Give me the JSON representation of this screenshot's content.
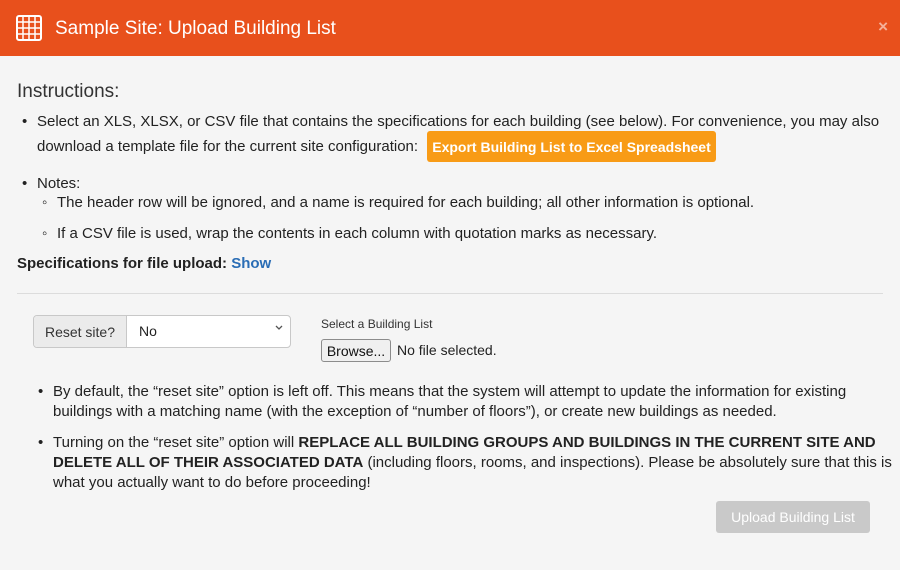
{
  "header": {
    "title": "Sample Site: Upload Building List",
    "close_label": "×",
    "icon": "building-icon",
    "background": "#e8501c"
  },
  "instructions": {
    "title": "Instructions:",
    "bullet1_line1": "Select an XLS, XLSX, or CSV file that contains the specifications for each building (see below). For convenience, you may also",
    "bullet1_line2": "download a template file for the current site configuration:",
    "export_button": "Export Building List to Excel Spreadsheet",
    "notes_label": "Notes:",
    "note1": "The header row will be ignored, and a name is required for each building; all other information is optional.",
    "note2": "If a CSV file is used, wrap the contents in each column with quotation marks as necessary."
  },
  "specifications": {
    "label": "Specifications for file upload:",
    "link": "Show"
  },
  "reset": {
    "label": "Reset site?",
    "selected": "No"
  },
  "file": {
    "label": "Select a Building List",
    "browse": "Browse...",
    "status": "No file selected."
  },
  "info": {
    "b1_line1": "By default, the “reset site” option is left off. This means that the system will attempt to update the information for existing",
    "b1_line2": "buildings with a matching name (with the exception of “number of floors”), or create new buildings as needed.",
    "b2_line1_a": "Turning on the “reset site” option will ",
    "b2_line1_b": "REPLACE ALL BUILDING GROUPS AND BUILDINGS IN THE CURRENT SITE AND",
    "b2_line2_a": "DELETE ALL OF THEIR ASSOCIATED DATA",
    "b2_line2_b": " (including floors, rooms, and inspections). Please be absolutely sure that this is",
    "b2_line3": "what you actually want to do before proceeding!"
  },
  "upload_button": "Upload Building List",
  "colors": {
    "accent": "#e8501c",
    "export_button": "#f89b16",
    "link": "#2a6db5",
    "disabled_button": "#c9c9c9"
  }
}
